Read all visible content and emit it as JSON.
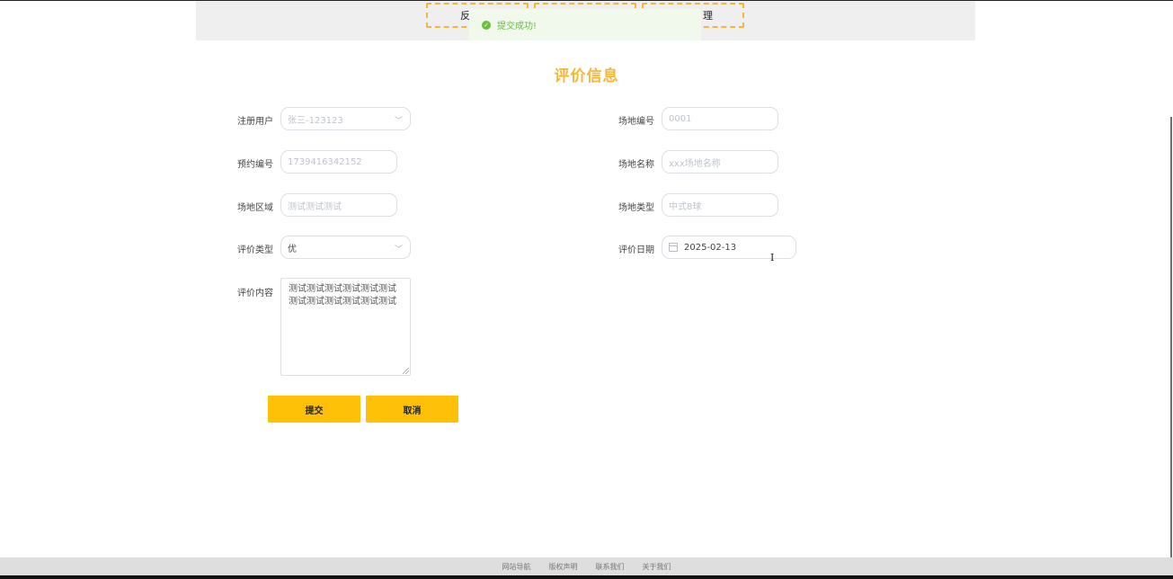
{
  "nav": {
    "tabs": [
      {
        "label": "反"
      },
      {
        "label": ""
      },
      {
        "label": "理"
      }
    ]
  },
  "toast": {
    "message": "提交成功!"
  },
  "page_title": "评价信息",
  "form": {
    "user": {
      "label": "注册用户",
      "placeholder": "张三-123123"
    },
    "venue_no": {
      "label": "场地编号",
      "placeholder": "0001"
    },
    "booking_no": {
      "label": "预约编号",
      "placeholder": "1739416342152"
    },
    "venue_name": {
      "label": "场地名称",
      "placeholder": "xxx场地名称"
    },
    "venue_area": {
      "label": "场地区域",
      "placeholder": "测试测试测试"
    },
    "venue_type": {
      "label": "场地类型",
      "placeholder": "中式8球"
    },
    "review_type": {
      "label": "评价类型",
      "value": "优"
    },
    "review_date": {
      "label": "评价日期",
      "value": "2025-02-13"
    },
    "review_content": {
      "label": "评价内容",
      "value": "测试测试测试测试测试测试测试测试测试测试测试测试"
    }
  },
  "buttons": {
    "submit": "提交",
    "cancel": "取消"
  },
  "footer": {
    "links": [
      "网站导航",
      "版权声明",
      "联系我们",
      "关于我们"
    ]
  },
  "colors": {
    "accent": "#f5b73b",
    "button": "#ffc107",
    "success": "#67c23a",
    "success_bg": "#f0f9eb"
  }
}
